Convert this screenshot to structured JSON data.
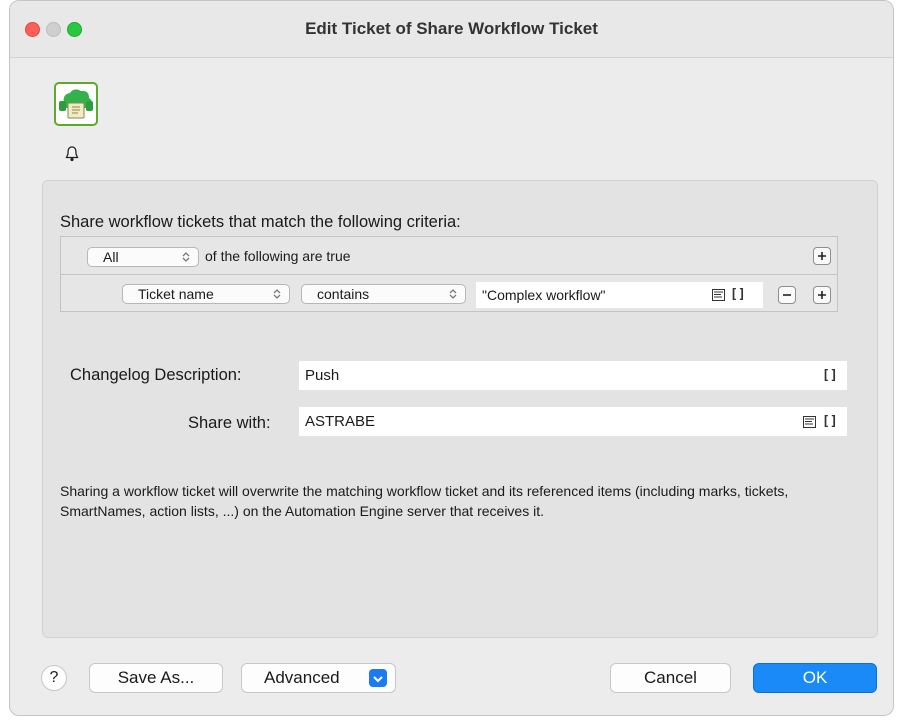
{
  "window": {
    "title": "Edit Ticket of Share Workflow Ticket"
  },
  "criteria": {
    "heading": "Share workflow tickets that match the following criteria:",
    "match_select": "All",
    "match_suffix": "of the following are true",
    "rule": {
      "field": "Ticket name",
      "operator": "contains",
      "value": "\"Complex workflow\""
    }
  },
  "changelog": {
    "label": "Changelog Description:",
    "value": "Push"
  },
  "share_with": {
    "label": "Share with:",
    "value": "ASTRABE"
  },
  "brackets_text": "[]",
  "description": "Sharing a workflow ticket will overwrite the matching workflow ticket and its referenced items (including marks, tickets, SmartNames, action lists, ...) on the Automation Engine server that receives it.",
  "buttons": {
    "help": "?",
    "save_as": "Save As...",
    "advanced": "Advanced",
    "cancel": "Cancel",
    "ok": "OK"
  },
  "colors": {
    "accent": "#1a8af8",
    "icon_green": "#5fa82e",
    "close": "#fe5f57",
    "maximize": "#28c840"
  },
  "icons": [
    "ticket-icon",
    "bell-icon",
    "chevron-updown-icon",
    "plus-icon",
    "minus-icon",
    "list-icon",
    "chevron-down-icon"
  ]
}
